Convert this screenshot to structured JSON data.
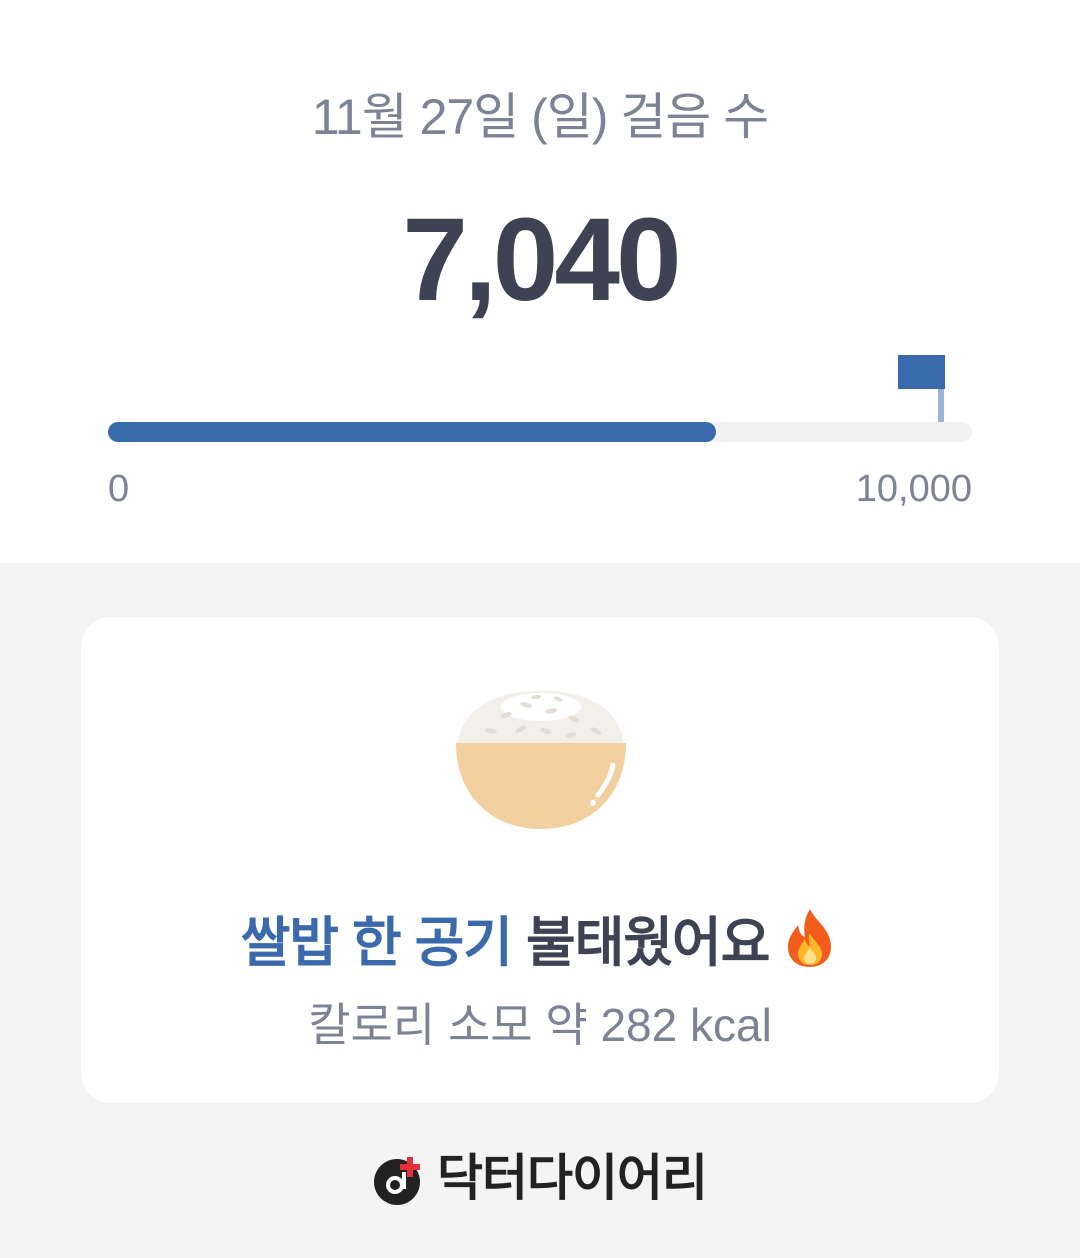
{
  "header": {
    "title": "11월 27일 (일) 걸음 수",
    "steps": "7,040"
  },
  "progress": {
    "value": 7040,
    "goal": 10000,
    "min_label": "0",
    "max_label": "10,000",
    "fill_color": "#3a6aac",
    "goal_flag_icon": "flag-icon"
  },
  "card": {
    "illustration": "rice-bowl-icon",
    "headline_highlight": "쌀밥 한 공기",
    "headline_rest": "불태웠어요",
    "headline_icon": "fire-icon",
    "calorie_text": "칼로리 소모 약 282 kcal"
  },
  "footer": {
    "brand_icon": "doctor-diary-logo-icon",
    "brand_name": "닥터다이어리"
  },
  "colors": {
    "accent": "#3a6aac",
    "text_dark": "#3e4253",
    "text_muted": "#7d8294",
    "background": "#f4f4f4"
  }
}
